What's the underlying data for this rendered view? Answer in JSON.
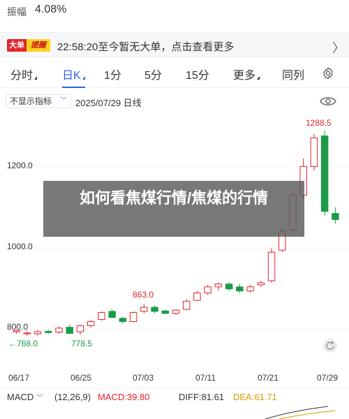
{
  "header": {
    "amplitude_label": "振幅",
    "amplitude_value": "4.08%"
  },
  "news": {
    "logo_part1": "大单",
    "logo_part2": "提醒",
    "text": "22:58:20至今暂无大单，点击查看更多",
    "chevron": "〉"
  },
  "tabs": [
    {
      "label": "分时",
      "has_caret": true
    },
    {
      "label": "日K",
      "active": true,
      "has_caret": true
    },
    {
      "label": "1分"
    },
    {
      "label": "5分"
    },
    {
      "label": "15分"
    },
    {
      "label": "更多",
      "has_caret": true
    },
    {
      "label": "同列"
    }
  ],
  "indicator": {
    "select_label": "不显示指标",
    "date": "2025/07/29 日线"
  },
  "overlay": {
    "title": "如何看焦煤行情/焦煤的行情"
  },
  "macd": {
    "name": "MACD",
    "params": "(12,26,9)",
    "macd": "MACD:39.80",
    "diff": "DIFF:81.61",
    "dea": "DEA:61.71"
  },
  "colors": {
    "up": "#e2232b",
    "down": "#1a9b48",
    "accent": "#2a62e0"
  },
  "chart_data": {
    "type": "candlestick",
    "ylim": [
      790,
      1300
    ],
    "ytick_labels": [
      "1200.0",
      "1000.0",
      "800.0"
    ],
    "max_label": "1288.5",
    "min_label": "←768.0",
    "mark_label_1": "863.0",
    "mark_label_2": "778.5",
    "date_ticks": [
      "06/17",
      "06/25",
      "07/03",
      "07/11",
      "07/21",
      "07/29"
    ],
    "candles": [
      {
        "o": 795,
        "h": 800,
        "l": 790,
        "c": 798
      },
      {
        "o": 790,
        "h": 796,
        "l": 785,
        "c": 792
      },
      {
        "o": 790,
        "h": 800,
        "l": 786,
        "c": 795
      },
      {
        "o": 796,
        "h": 800,
        "l": 790,
        "c": 793
      },
      {
        "o": 794,
        "h": 808,
        "l": 790,
        "c": 804
      },
      {
        "o": 806,
        "h": 812,
        "l": 790,
        "c": 791
      },
      {
        "o": 795,
        "h": 812,
        "l": 788,
        "c": 810
      },
      {
        "o": 810,
        "h": 824,
        "l": 805,
        "c": 820
      },
      {
        "o": 825,
        "h": 845,
        "l": 822,
        "c": 842
      },
      {
        "o": 845,
        "h": 850,
        "l": 828,
        "c": 830
      },
      {
        "o": 828,
        "h": 832,
        "l": 815,
        "c": 820
      },
      {
        "o": 820,
        "h": 845,
        "l": 818,
        "c": 842
      },
      {
        "o": 845,
        "h": 863,
        "l": 840,
        "c": 855
      },
      {
        "o": 855,
        "h": 860,
        "l": 840,
        "c": 845
      },
      {
        "o": 846,
        "h": 850,
        "l": 838,
        "c": 840
      },
      {
        "o": 840,
        "h": 850,
        "l": 836,
        "c": 848
      },
      {
        "o": 850,
        "h": 875,
        "l": 848,
        "c": 870
      },
      {
        "o": 872,
        "h": 895,
        "l": 870,
        "c": 890
      },
      {
        "o": 890,
        "h": 910,
        "l": 885,
        "c": 905
      },
      {
        "o": 905,
        "h": 915,
        "l": 895,
        "c": 912
      },
      {
        "o": 912,
        "h": 916,
        "l": 895,
        "c": 900
      },
      {
        "o": 905,
        "h": 912,
        "l": 890,
        "c": 895
      },
      {
        "o": 895,
        "h": 910,
        "l": 890,
        "c": 905
      },
      {
        "o": 910,
        "h": 920,
        "l": 905,
        "c": 915
      },
      {
        "o": 920,
        "h": 1000,
        "l": 915,
        "c": 990
      },
      {
        "o": 995,
        "h": 1050,
        "l": 990,
        "c": 1040
      },
      {
        "o": 1045,
        "h": 1140,
        "l": 1040,
        "c": 1130
      },
      {
        "o": 1130,
        "h": 1220,
        "l": 1120,
        "c": 1200
      },
      {
        "o": 1200,
        "h": 1280,
        "l": 1190,
        "c": 1270
      },
      {
        "o": 1275,
        "h": 1288.5,
        "l": 1080,
        "c": 1090
      },
      {
        "o": 1085,
        "h": 1100,
        "l": 1060,
        "c": 1070
      }
    ]
  }
}
